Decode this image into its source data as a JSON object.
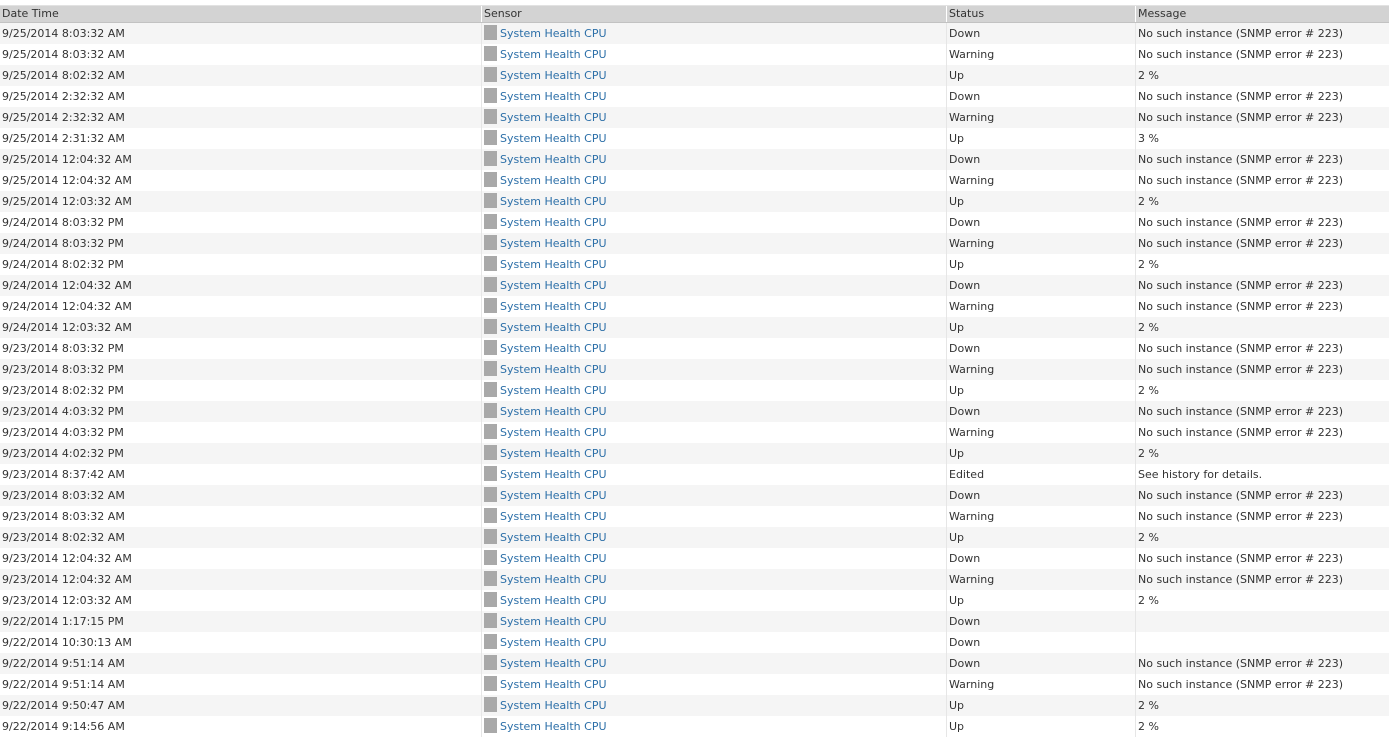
{
  "columns": {
    "datetime": "Date Time",
    "sensor": "Sensor",
    "status": "Status",
    "message": "Message"
  },
  "colors": {
    "header_bg": "#d3d3d3",
    "row_alt": "#f5f5f5",
    "link": "#2c6fa8",
    "icon": "#a9a9a9"
  },
  "rows": [
    {
      "datetime": "9/25/2014 8:03:32 AM",
      "sensor": "System Health CPU",
      "status": "Down",
      "message": "No such instance (SNMP error # 223)"
    },
    {
      "datetime": "9/25/2014 8:03:32 AM",
      "sensor": "System Health CPU",
      "status": "Warning",
      "message": "No such instance (SNMP error # 223)"
    },
    {
      "datetime": "9/25/2014 8:02:32 AM",
      "sensor": "System Health CPU",
      "status": "Up",
      "message": "2 %"
    },
    {
      "datetime": "9/25/2014 2:32:32 AM",
      "sensor": "System Health CPU",
      "status": "Down",
      "message": "No such instance (SNMP error # 223)"
    },
    {
      "datetime": "9/25/2014 2:32:32 AM",
      "sensor": "System Health CPU",
      "status": "Warning",
      "message": "No such instance (SNMP error # 223)"
    },
    {
      "datetime": "9/25/2014 2:31:32 AM",
      "sensor": "System Health CPU",
      "status": "Up",
      "message": "3 %"
    },
    {
      "datetime": "9/25/2014 12:04:32 AM",
      "sensor": "System Health CPU",
      "status": "Down",
      "message": "No such instance (SNMP error # 223)"
    },
    {
      "datetime": "9/25/2014 12:04:32 AM",
      "sensor": "System Health CPU",
      "status": "Warning",
      "message": "No such instance (SNMP error # 223)"
    },
    {
      "datetime": "9/25/2014 12:03:32 AM",
      "sensor": "System Health CPU",
      "status": "Up",
      "message": "2 %"
    },
    {
      "datetime": "9/24/2014 8:03:32 PM",
      "sensor": "System Health CPU",
      "status": "Down",
      "message": "No such instance (SNMP error # 223)"
    },
    {
      "datetime": "9/24/2014 8:03:32 PM",
      "sensor": "System Health CPU",
      "status": "Warning",
      "message": "No such instance (SNMP error # 223)"
    },
    {
      "datetime": "9/24/2014 8:02:32 PM",
      "sensor": "System Health CPU",
      "status": "Up",
      "message": "2 %"
    },
    {
      "datetime": "9/24/2014 12:04:32 AM",
      "sensor": "System Health CPU",
      "status": "Down",
      "message": "No such instance (SNMP error # 223)"
    },
    {
      "datetime": "9/24/2014 12:04:32 AM",
      "sensor": "System Health CPU",
      "status": "Warning",
      "message": "No such instance (SNMP error # 223)"
    },
    {
      "datetime": "9/24/2014 12:03:32 AM",
      "sensor": "System Health CPU",
      "status": "Up",
      "message": "2 %"
    },
    {
      "datetime": "9/23/2014 8:03:32 PM",
      "sensor": "System Health CPU",
      "status": "Down",
      "message": "No such instance (SNMP error # 223)"
    },
    {
      "datetime": "9/23/2014 8:03:32 PM",
      "sensor": "System Health CPU",
      "status": "Warning",
      "message": "No such instance (SNMP error # 223)"
    },
    {
      "datetime": "9/23/2014 8:02:32 PM",
      "sensor": "System Health CPU",
      "status": "Up",
      "message": "2 %"
    },
    {
      "datetime": "9/23/2014 4:03:32 PM",
      "sensor": "System Health CPU",
      "status": "Down",
      "message": "No such instance (SNMP error # 223)"
    },
    {
      "datetime": "9/23/2014 4:03:32 PM",
      "sensor": "System Health CPU",
      "status": "Warning",
      "message": "No such instance (SNMP error # 223)"
    },
    {
      "datetime": "9/23/2014 4:02:32 PM",
      "sensor": "System Health CPU",
      "status": "Up",
      "message": "2 %"
    },
    {
      "datetime": "9/23/2014 8:37:42 AM",
      "sensor": "System Health CPU",
      "status": "Edited",
      "message": "See history for details."
    },
    {
      "datetime": "9/23/2014 8:03:32 AM",
      "sensor": "System Health CPU",
      "status": "Down",
      "message": "No such instance (SNMP error # 223)"
    },
    {
      "datetime": "9/23/2014 8:03:32 AM",
      "sensor": "System Health CPU",
      "status": "Warning",
      "message": "No such instance (SNMP error # 223)"
    },
    {
      "datetime": "9/23/2014 8:02:32 AM",
      "sensor": "System Health CPU",
      "status": "Up",
      "message": "2 %"
    },
    {
      "datetime": "9/23/2014 12:04:32 AM",
      "sensor": "System Health CPU",
      "status": "Down",
      "message": "No such instance (SNMP error # 223)"
    },
    {
      "datetime": "9/23/2014 12:04:32 AM",
      "sensor": "System Health CPU",
      "status": "Warning",
      "message": "No such instance (SNMP error # 223)"
    },
    {
      "datetime": "9/23/2014 12:03:32 AM",
      "sensor": "System Health CPU",
      "status": "Up",
      "message": "2 %"
    },
    {
      "datetime": "9/22/2014 1:17:15 PM",
      "sensor": "System Health CPU",
      "status": "Down",
      "message": ""
    },
    {
      "datetime": "9/22/2014 10:30:13 AM",
      "sensor": "System Health CPU",
      "status": "Down",
      "message": ""
    },
    {
      "datetime": "9/22/2014 9:51:14 AM",
      "sensor": "System Health CPU",
      "status": "Down",
      "message": "No such instance (SNMP error # 223)"
    },
    {
      "datetime": "9/22/2014 9:51:14 AM",
      "sensor": "System Health CPU",
      "status": "Warning",
      "message": "No such instance (SNMP error # 223)"
    },
    {
      "datetime": "9/22/2014 9:50:47 AM",
      "sensor": "System Health CPU",
      "status": "Up",
      "message": "2 %"
    },
    {
      "datetime": "9/22/2014 9:14:56 AM",
      "sensor": "System Health CPU",
      "status": "Up",
      "message": "2 %"
    }
  ]
}
